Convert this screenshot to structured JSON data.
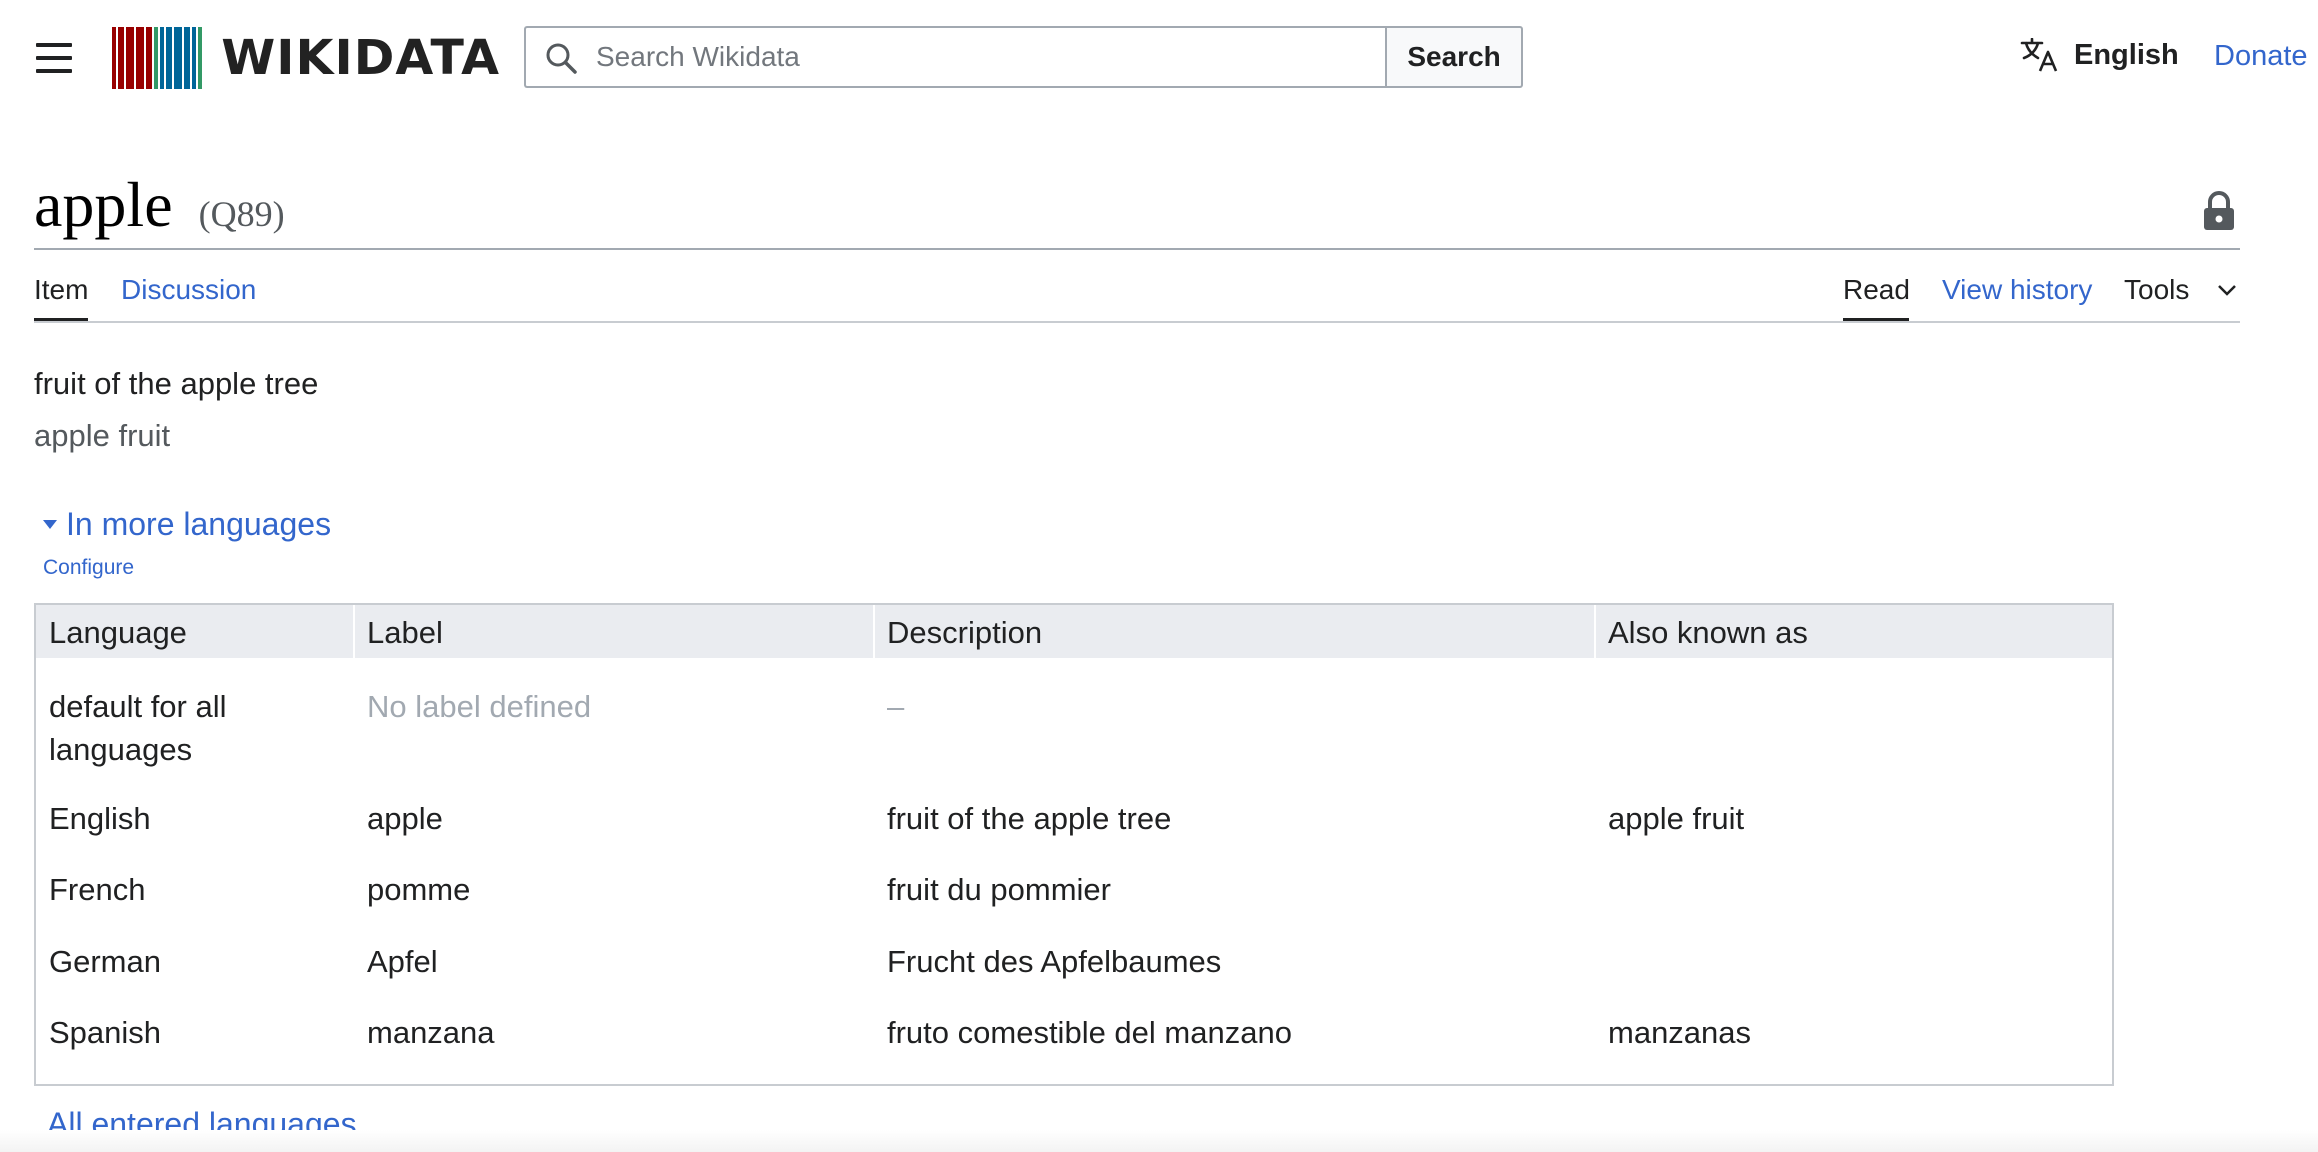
{
  "header": {
    "logo_text": "WIKIDATA",
    "logo_bar_colors": [
      "#990000",
      "#990000",
      "#990000",
      "#990000",
      "#990000",
      "#339966",
      "#006699",
      "#006699",
      "#006699",
      "#006699",
      "#006699",
      "#339966"
    ],
    "search_placeholder": "Search Wikidata",
    "search_button": "Search",
    "language": "English",
    "donate": "Donate"
  },
  "page": {
    "title": "apple",
    "qid": "(Q89)"
  },
  "tabs": {
    "item": "Item",
    "discussion": "Discussion",
    "read": "Read",
    "view_history": "View history",
    "tools": "Tools"
  },
  "entity": {
    "description": "fruit of the apple tree",
    "alias": "apple fruit"
  },
  "languages_section": {
    "toggle": "In more languages",
    "configure": "Configure",
    "columns": [
      "Language",
      "Label",
      "Description",
      "Also known as"
    ],
    "rows": [
      {
        "language": "default for all languages",
        "label": "No label defined",
        "description": "–",
        "aliases": ""
      },
      {
        "language": "English",
        "label": "apple",
        "description": "fruit of the apple tree",
        "aliases": "apple fruit"
      },
      {
        "language": "French",
        "label": "pomme",
        "description": "fruit du pommier",
        "aliases": ""
      },
      {
        "language": "German",
        "label": "Apfel",
        "description": "Frucht des Apfelbaumes",
        "aliases": ""
      },
      {
        "language": "Spanish",
        "label": "manzana",
        "description": "fruto comestible del manzano",
        "aliases": "manzanas"
      }
    ],
    "all_languages": "All entered languages"
  },
  "colors": {
    "link": "#3366cc",
    "text": "#202122",
    "muted": "#a2a9b1",
    "header_bg": "#eaecf0"
  },
  "icons": [
    "menu-icon",
    "search-icon",
    "translate-icon",
    "lock-icon",
    "chevron-down-icon",
    "triangle-down-icon"
  ]
}
